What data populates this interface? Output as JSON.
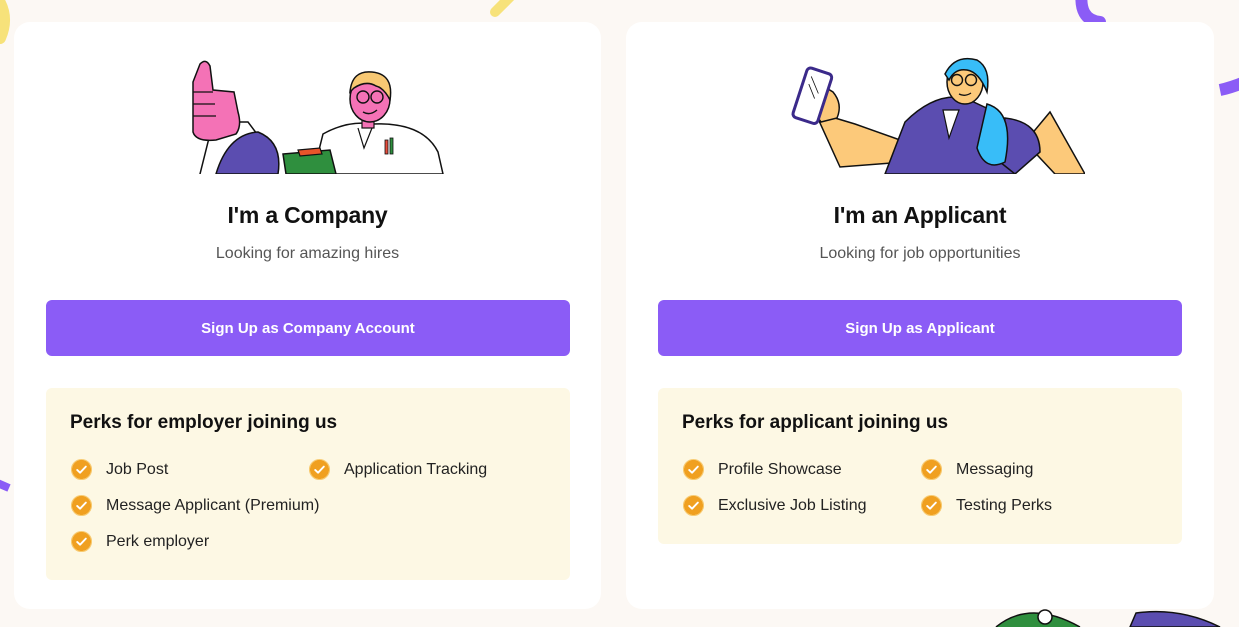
{
  "colors": {
    "background": "#fcf8f4",
    "card": "#ffffff",
    "primary_button": "#8b5cf6",
    "perks_panel": "#fdf8e4",
    "check_icon": "#f0a020"
  },
  "company": {
    "illustration": "company-person-thumbs-up-illustration",
    "title": "I'm a Company",
    "subtitle": "Looking for amazing hires",
    "signup_label": "Sign Up as Company Account",
    "perks_title": "Perks for employer joining us",
    "perks": [
      "Job Post",
      "Application Tracking",
      "Message Applicant (Premium)",
      "Perk employer"
    ]
  },
  "applicant": {
    "illustration": "applicant-person-phone-illustration",
    "title": "I'm an Applicant",
    "subtitle": "Looking for job opportunities",
    "signup_label": "Sign Up as Applicant",
    "perks_title": "Perks for applicant joining us",
    "perks": [
      "Profile Showcase",
      "Messaging",
      "Exclusive Job Listing",
      "Testing Perks"
    ]
  }
}
